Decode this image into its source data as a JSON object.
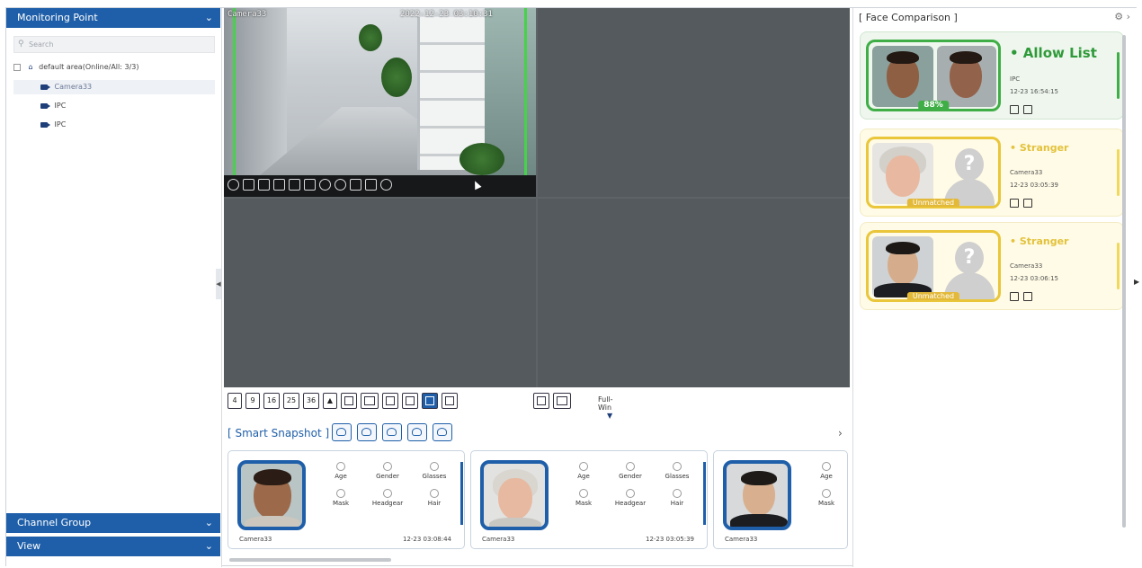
{
  "left_panel": {
    "monitoring_point_label": "Monitoring Point",
    "search_placeholder": "Search",
    "area_label": "default area(Online/All: 3/3)",
    "channels": [
      {
        "label": "Camera33"
      },
      {
        "label": "IPC"
      },
      {
        "label": "IPC"
      }
    ],
    "channel_group_label": "Channel Group",
    "view_label": "View"
  },
  "video": {
    "osd_name": "Camera33",
    "osd_timestamp": "2022-12-23 03:10:31"
  },
  "layout_toolbar": {
    "grid_options": [
      "4",
      "9",
      "16",
      "25",
      "36"
    ],
    "full_win_label": "Full-Win"
  },
  "smart_snapshot": {
    "title": "[ Smart Snapshot ]",
    "attribute_labels": [
      "Age",
      "Gender",
      "Glasses",
      "Mask",
      "Headgear",
      "Hair"
    ],
    "cards": [
      {
        "camera": "Camera33",
        "time": "12-23 03:08:44"
      },
      {
        "camera": "Camera33",
        "time": "12-23 03:05:39"
      },
      {
        "camera": "Camera33",
        "time": ""
      }
    ]
  },
  "face_comparison": {
    "title": "[ Face Comparison ]",
    "cards": [
      {
        "status": "• Allow List",
        "source": "IPC",
        "time": "12-23 16:54:15",
        "badge": "88%",
        "accent": "#3fae46"
      },
      {
        "status": "• Stranger",
        "source": "Camera33",
        "time": "12-23 03:05:39",
        "badge": "Unmatched",
        "accent": "#e9c63a"
      },
      {
        "status": "• Stranger",
        "source": "Camera33",
        "time": "12-23 03:06:15",
        "badge": "Unmatched",
        "accent": "#e9c63a"
      }
    ]
  },
  "theme": {
    "primary": "#1f5fa9",
    "allow": "#3fae46",
    "stranger": "#e9c63a"
  }
}
